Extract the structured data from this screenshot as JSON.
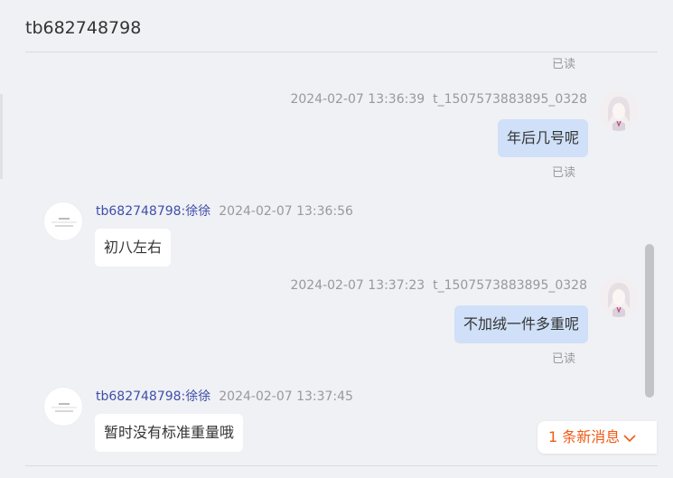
{
  "header": {
    "title": "tb682748798"
  },
  "messages": [
    {
      "read": "已读"
    },
    {
      "timestamp": "2024-02-07 13:36:39",
      "sender": "t_1507573883895_0328",
      "text": "年后几号呢",
      "read": "已读"
    },
    {
      "name": "tb682748798:徐徐",
      "timestamp": "2024-02-07 13:36:56",
      "text": "初八左右"
    },
    {
      "timestamp": "2024-02-07 13:37:23",
      "sender": "t_1507573883895_0328",
      "text": "不加绒一件多重呢",
      "read": "已读"
    },
    {
      "name": "tb682748798:徐徐",
      "timestamp": "2024-02-07 13:37:45",
      "text": "暂时没有标准重量哦"
    }
  ],
  "new_messages": {
    "label": "1 条新消息"
  },
  "colors": {
    "background": "#f0f1f5",
    "outgoing_bubble": "#cfe0f8",
    "incoming_bubble": "#ffffff",
    "shop_name": "#3f4fa8",
    "new_message_accent": "#f05a14"
  },
  "icons": {
    "user_avatar": "user-avatar",
    "shop_avatar": "shop-logo-avatar",
    "new_message_arrow": "chevron-down-icon"
  }
}
